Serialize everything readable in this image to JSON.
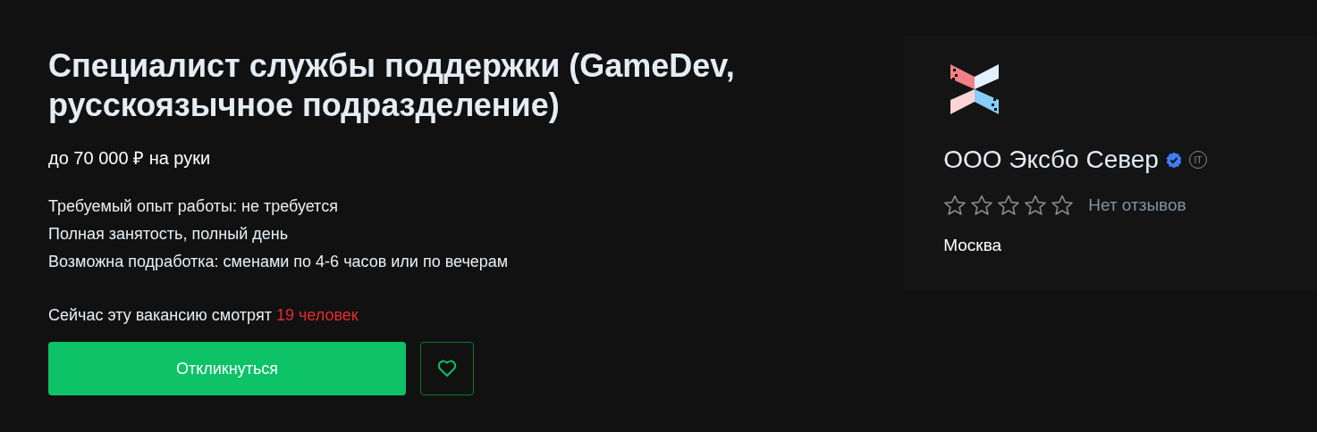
{
  "vacancy": {
    "title": "Специалист службы поддержки (GameDev, русскоязычное подразделение)",
    "salary": "до 70 000 ₽ на руки",
    "details": [
      "Требуемый опыт работы: не требуется",
      "Полная занятость, полный день",
      "Возможна подработка: сменами по 4-6 часов или по вечерам"
    ],
    "viewers": {
      "text": "Сейчас эту вакансию смотрят",
      "highlight": "19 человек"
    },
    "apply_button": "Откликнуться",
    "favorite": {
      "selected": false
    }
  },
  "company": {
    "name": "ООО Эксбо Север",
    "verified": true,
    "it_badge": "IT",
    "stars": 0,
    "reviews": "Нет отзывов",
    "city": "Москва"
  }
}
